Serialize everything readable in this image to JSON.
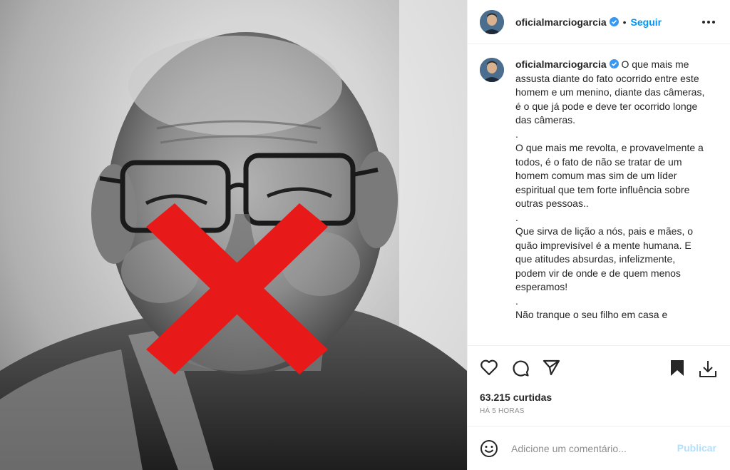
{
  "post": {
    "image_alt": "Black and white portrait of a smiling man with glasses and a red X over his mouth",
    "overlay_color": "#e81919"
  },
  "header": {
    "username": "oficialmarciogarcia",
    "separator": "•",
    "follow_label": "Seguir",
    "more_icon": "more-options-icon"
  },
  "caption": {
    "username": "oficialmarciogarcia",
    "paragraphs": [
      "O que mais me assusta diante do fato ocorrido entre este homem e um menino, diante das câmeras, é o que já pode e deve ter ocorrido longe das câmeras.",
      ".",
      "O que mais me revolta, e provavelmente a todos, é o fato de não se tratar de um homem comum mas sim de um líder espiritual que tem forte influência sobre outras pessoas..",
      ".",
      "Que sirva de lição a nós, pais e mães, o quão imprevisível é a mente humana. E que atitudes absurdas, infelizmente, podem vir de onde e de quem menos esperamos!",
      ".",
      "Não tranque o seu filho em casa e"
    ]
  },
  "actions": {
    "like_icon": "heart-icon",
    "comment_icon": "comment-icon",
    "share_icon": "share-icon",
    "save_icon": "bookmark-icon",
    "download_icon": "download-icon"
  },
  "stats": {
    "likes": "63.215 curtidas",
    "time": "HÁ 5 HORAS"
  },
  "comment_box": {
    "placeholder": "Adicione um comentário...",
    "publish_label": "Publicar",
    "emoji_icon": "emoji-icon"
  },
  "colors": {
    "accent": "#0095f6",
    "publish_disabled": "#b2dffc",
    "muted": "#8e8e8e",
    "verified": "#3897f0"
  }
}
